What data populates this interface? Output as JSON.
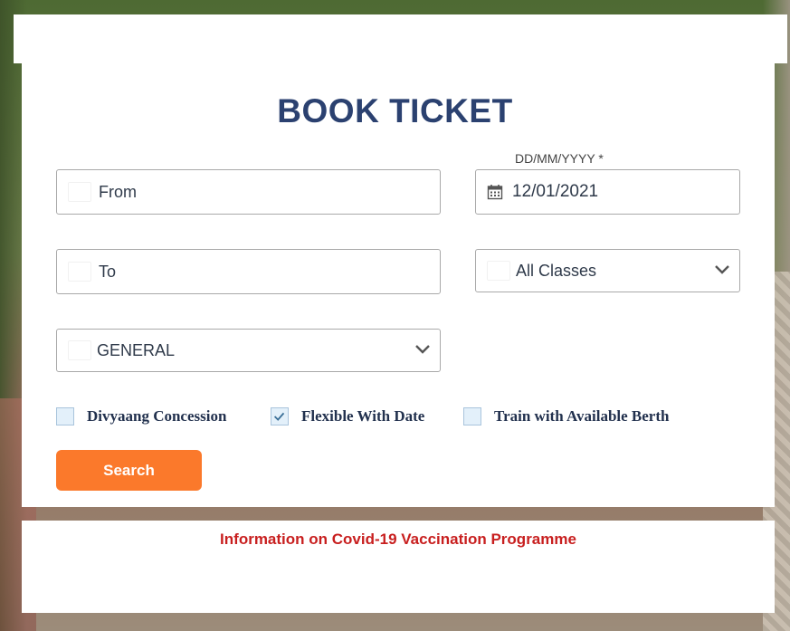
{
  "booking": {
    "title": "BOOK TICKET",
    "from_placeholder": "From",
    "to_placeholder": "To",
    "date_label": "DD/MM/YYYY *",
    "date_value": "12/01/2021",
    "class_selected": "All Classes",
    "quota_selected": "GENERAL",
    "search_label": "Search"
  },
  "checkboxes": [
    {
      "label": "Divyaang Concession",
      "checked": false
    },
    {
      "label": "Flexible With Date",
      "checked": true
    },
    {
      "label": "Train with Available Berth",
      "checked": false
    }
  ],
  "info": {
    "covid_link": "Information on Covid-19 Vaccination Programme"
  },
  "colors": {
    "title": "#2b4170",
    "search_button": "#fb792b",
    "covid_text": "#c81f1f"
  },
  "icons": {
    "date": "calendar-icon",
    "dropdown": "chevron-down-icon",
    "check": "checkmark-icon"
  }
}
